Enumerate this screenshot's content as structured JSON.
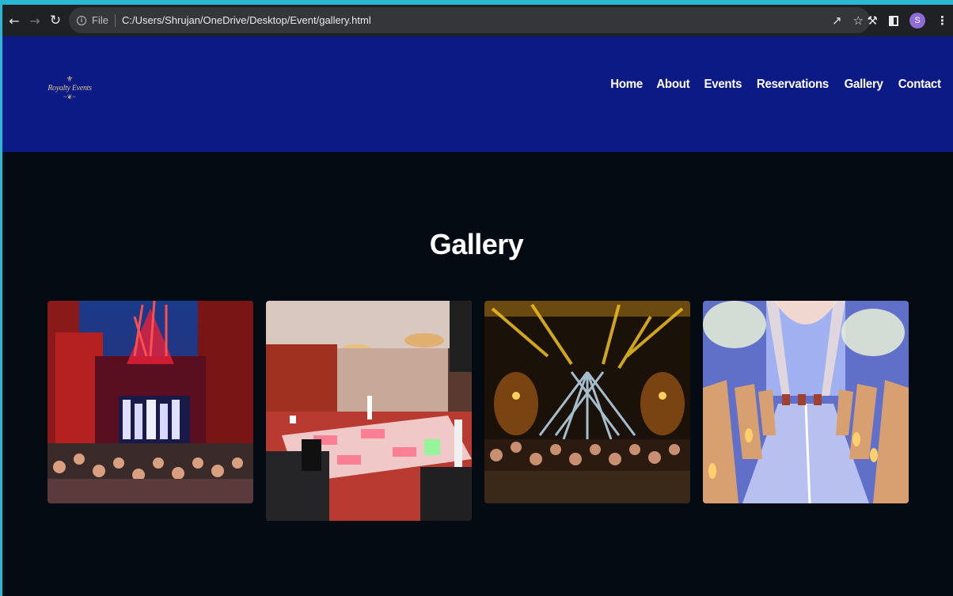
{
  "browser": {
    "back_icon": "arrow-left-icon",
    "forward_icon": "arrow-right-icon",
    "reload_icon": "reload-icon",
    "scheme_label": "File",
    "url": "C:/Users/Shrujan/OneDrive/Desktop/Event/gallery.html",
    "profile_initial": "S"
  },
  "site": {
    "logo_text": "Royalty Events",
    "nav": [
      {
        "label": "Home"
      },
      {
        "label": "About"
      },
      {
        "label": "Events"
      },
      {
        "label": "Reservations"
      },
      {
        "label": "Gallery"
      },
      {
        "label": "Contact"
      }
    ]
  },
  "gallery": {
    "title": "Gallery"
  },
  "colors": {
    "header_bg": "#0b1a85",
    "page_bg": "#050b13",
    "chrome_bg": "#202124"
  }
}
